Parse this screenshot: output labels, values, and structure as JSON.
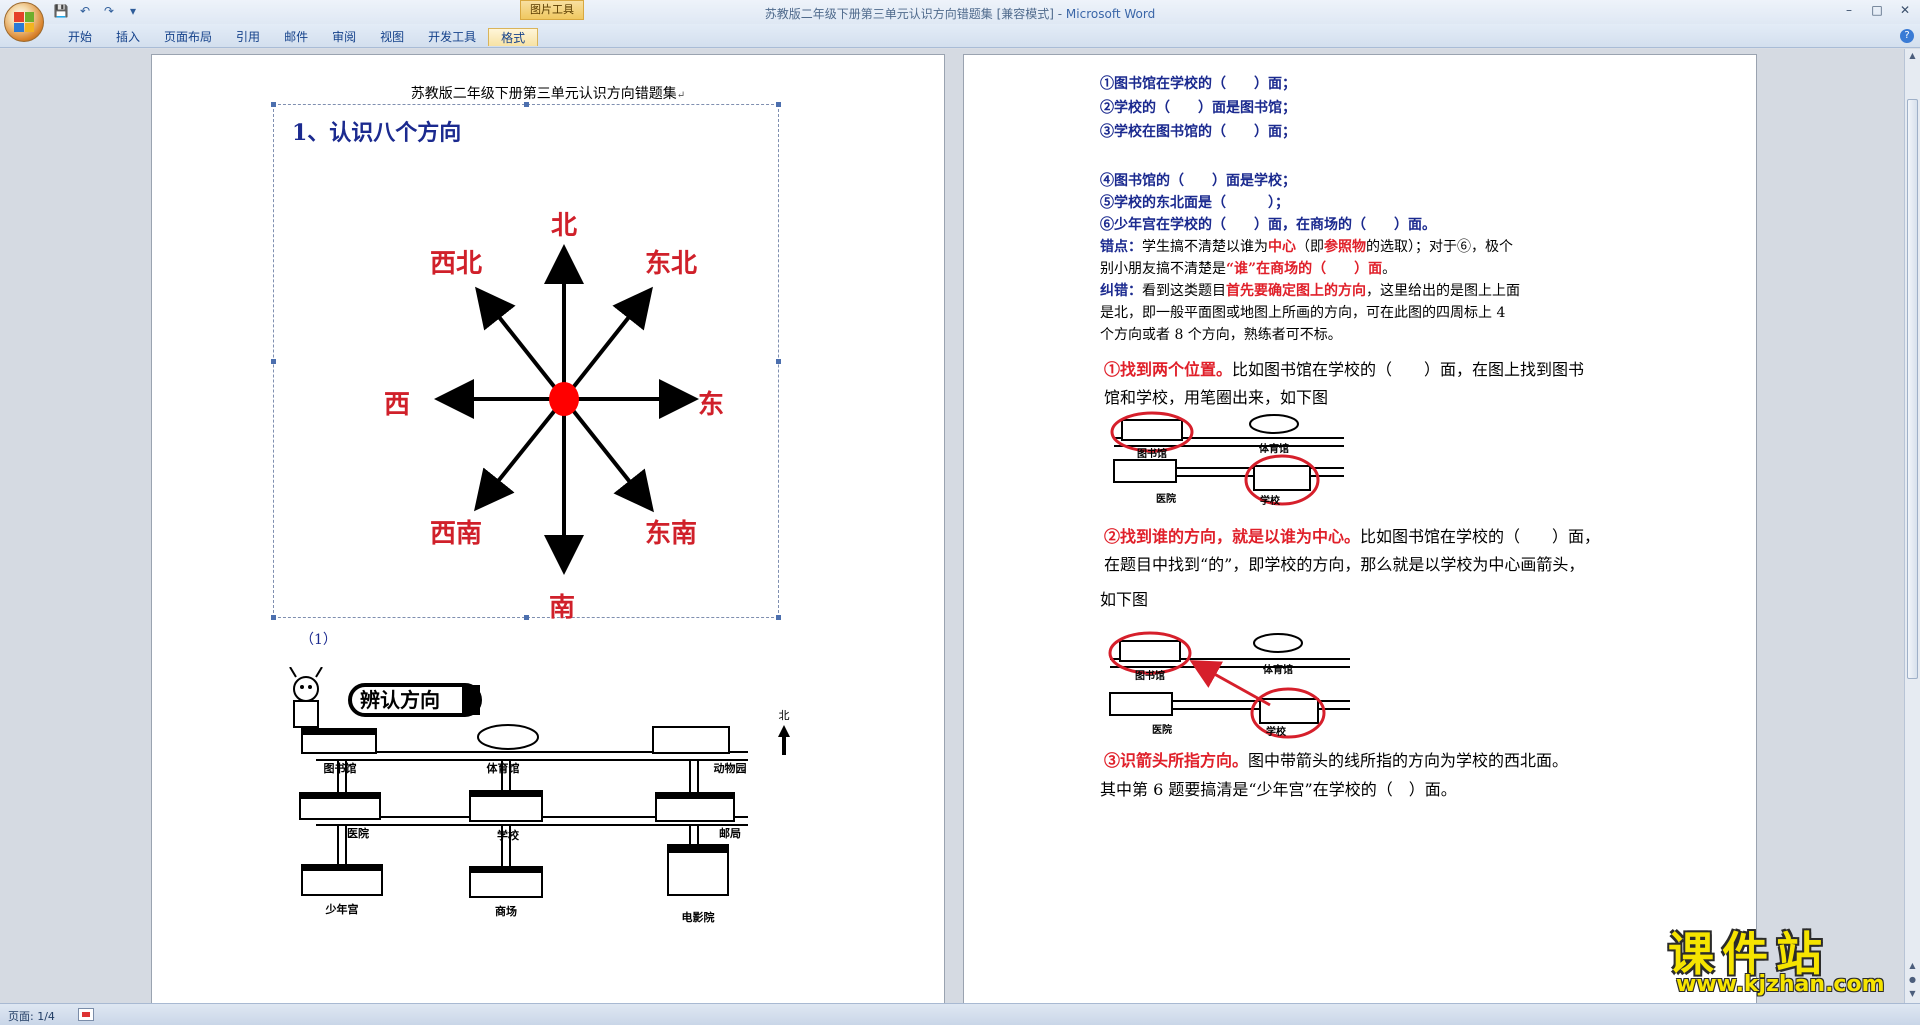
{
  "window": {
    "title": "苏教版二年级下册第三单元认识方向错题集 [兼容模式] - ",
    "app_name": "Microsoft Word",
    "contextual_tab_group": "图片工具"
  },
  "ribbon": {
    "tabs": [
      "开始",
      "插入",
      "页面布局",
      "引用",
      "邮件",
      "审阅",
      "视图",
      "开发工具",
      "格式"
    ]
  },
  "status": {
    "page": "页面: 1/4"
  },
  "page1": {
    "header": "苏教版二年级下册第三单元认识方向错题集",
    "section_title": "1、认识八个方向",
    "directions": {
      "north": "北",
      "south": "南",
      "east": "东",
      "west": "西",
      "northeast": "东北",
      "northwest": "西北",
      "southeast": "东南",
      "southwest": "西南"
    },
    "caption": "（1）",
    "map": {
      "banner": "辨认方向",
      "north_label": "北",
      "places": [
        "图书馆",
        "体育馆",
        "动物园",
        "医院",
        "学校",
        "邮局",
        "少年宫",
        "商场",
        "电影院"
      ]
    }
  },
  "page2": {
    "questions": [
      "①图书馆在学校的（　　）面；",
      "②学校的（　　）面是图书馆；",
      "③学校在图书馆的（　　）面；",
      "④图书馆的（　　）面是学校；",
      "⑤学校的东北面是（　　　）；",
      "⑥少年宫在学校的（　　）面，在商场的（　　）面。"
    ],
    "error_point": {
      "label": "错点：",
      "line1_a": "学生搞不清楚以谁为",
      "line1_b": "中心",
      "line1_c": "（即",
      "line1_d": "参照物",
      "line1_e": "的选取）；对于⑥，极个",
      "line2_a": "别小朋友搞不清楚是",
      "line2_b": "“谁”在商场的（　　）面",
      "line2_c": "。"
    },
    "correction": {
      "label": "纠错：",
      "line1_a": "看到这类题目",
      "line1_b": "首先要确定图上的方向",
      "line1_c": "，这里给出的是图上上面",
      "line2": "是北，即一般平面图或地图上所画的方向，可在此图的四周标上 4",
      "line3": "个方向或者 8 个方向，熟练者可不标。"
    },
    "step1": {
      "title": "①找到两个位置。",
      "text_a": "比如图书馆在学校的（　　）面，在图上找到图书",
      "text_b": "馆和学校，用笔圈出来，如下图"
    },
    "step2": {
      "title": "②找到谁的方向，就是以谁为中心。",
      "text_a": "比如图书馆在学校的（　　）面，",
      "text_b": "在题目中找到“的”，即学校的方向，那么就是以学校为中心画箭头，",
      "text_c": "如下图"
    },
    "step3": {
      "title": "③识箭头所指方向。",
      "text_a": "图中带箭头的线所指的方向为学校的西北面。",
      "text_b": "其中第 6 题要搞清是“少年宫”在学校的（　）面。"
    },
    "map_labels": {
      "library": "图书馆",
      "gym": "体育馆",
      "hospital": "医院",
      "school": "学校"
    }
  },
  "watermark": {
    "title": "课件站",
    "url": "www.kjzhan.com"
  },
  "colors": {
    "direction_red": "#d0202a",
    "doc_blue": "#1b2a8f",
    "accent_red": "#e0202a",
    "watermark_yellow": "#f6e400"
  }
}
